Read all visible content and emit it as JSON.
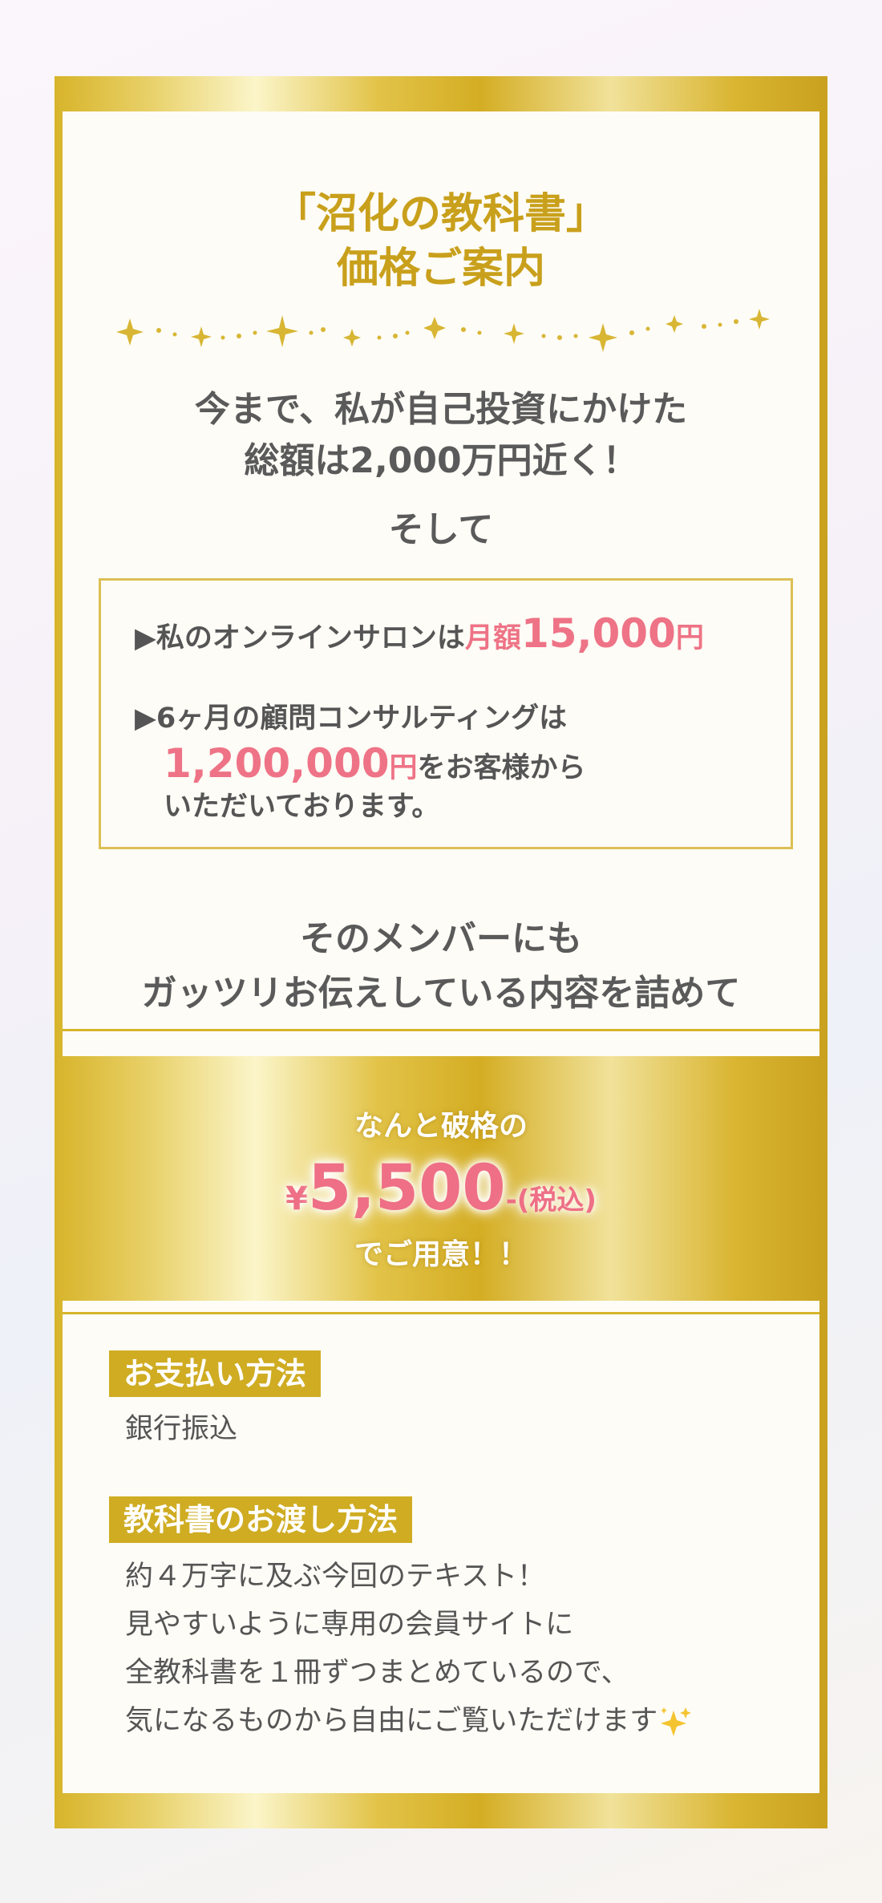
{
  "title": {
    "line1": "「沼化の教科書」",
    "line2": "価格ご案内"
  },
  "intro": {
    "line1": "今まで、私が自己投資にかけた",
    "line2": "総額は2,000万円近く！",
    "line3": "そして"
  },
  "box": {
    "salon_prefix": "▶私のオンラインサロンは",
    "salon_monthly": "月額",
    "salon_price": "15,000",
    "salon_yen": "円",
    "consult_line": "▶6ヶ月の顧問コンサルティングは",
    "consult_price": "1,200,000",
    "consult_yen": "円",
    "consult_suffix": "をお客様から",
    "consult_line3": "いただいております。"
  },
  "member": {
    "line1": "そのメンバーにも",
    "line2": "ガッツリお伝えしている内容を詰めて"
  },
  "offer": {
    "pre": "なんと破格の",
    "yen_mark": "¥",
    "price": "5,500",
    "suffix": "-(税込)",
    "post": "でご用意！！"
  },
  "payment": {
    "tag": "お支払い方法",
    "value": "銀行振込"
  },
  "delivery": {
    "tag": "教科書のお渡し方法",
    "line1": "約４万字に及ぶ今回のテキスト！",
    "line2": "見やすいように専用の会員サイトに",
    "line3": "全教科書を１冊ずつまとめているので、",
    "line4": "気になるものから自由にご覧いただけます",
    "sparkle_icon": "sparkles-emoji-icon"
  },
  "colors": {
    "gold": "#d7b42a",
    "pink": "#ee7386",
    "panel": "#fdfcf6"
  }
}
